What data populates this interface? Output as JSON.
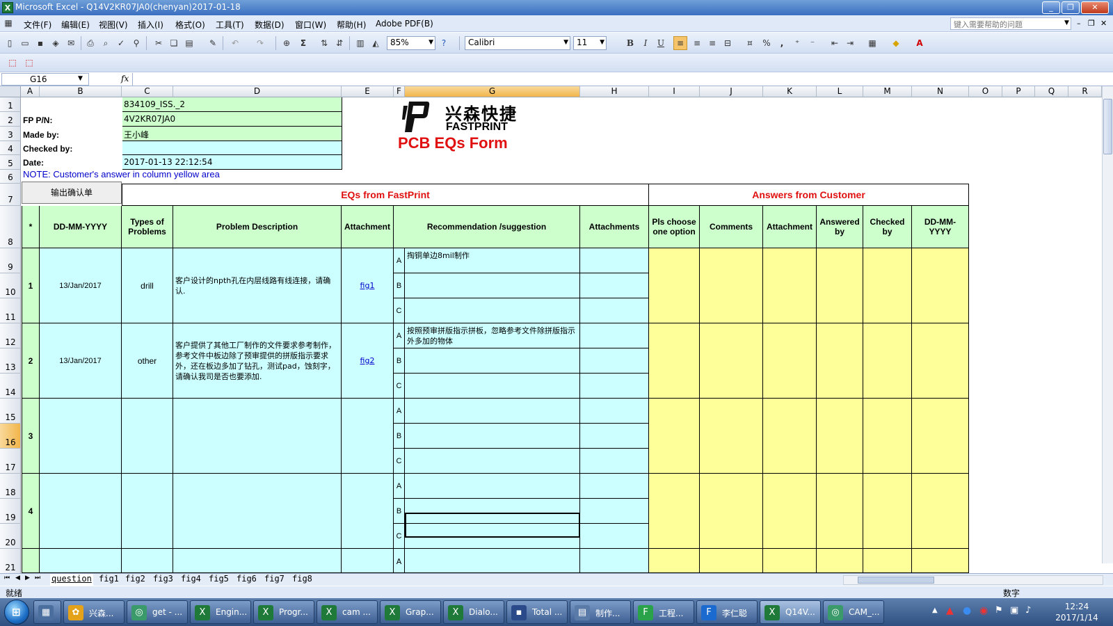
{
  "window": {
    "title": "Microsoft Excel - Q14V2KR07JA0(chenyan)2017-01-18",
    "icon_name": "excel-icon"
  },
  "menu": {
    "items": [
      "文件(F)",
      "编辑(E)",
      "视图(V)",
      "插入(I)",
      "格式(O)",
      "工具(T)",
      "数据(D)",
      "窗口(W)",
      "帮助(H)",
      "Adobe PDF(B)"
    ],
    "help_placeholder": "键入需要帮助的问题"
  },
  "toolbar": {
    "zoom": "85%",
    "font": "Calibri",
    "font_size": "11",
    "bold": "B",
    "italic": "I",
    "underline": "U",
    "percent": "%",
    "comma": ","
  },
  "formula_bar": {
    "name_box": "G16",
    "fx": "fx",
    "formula": ""
  },
  "columns": [
    "A",
    "B",
    "C",
    "D",
    "E",
    "F",
    "G",
    "H",
    "I",
    "J",
    "K",
    "L",
    "M",
    "N",
    "O",
    "P",
    "Q",
    "R"
  ],
  "selected_column": "G",
  "rows": [
    "1",
    "2",
    "3",
    "4",
    "5",
    "6",
    "7",
    "8",
    "9",
    "10",
    "11",
    "12",
    "13",
    "14",
    "15",
    "16",
    "17",
    "18",
    "19",
    "20",
    "21"
  ],
  "selected_row": "16",
  "form": {
    "header_labels": {
      "fp_pn": "FP P/N:",
      "made_by": "Made by:",
      "checked_by": "Checked by:",
      "date": "Date:"
    },
    "header_values": {
      "r1": "834109_ISS._2",
      "fp_pn": "4V2KR07JA0",
      "made_by": "王小峰",
      "checked_by": "",
      "date": "2017-01-13 22:12:54"
    },
    "logo": {
      "cn": "兴森快捷",
      "en": "FASTPRINT"
    },
    "title": "PCB EQs Form",
    "note": "NOTE: Customer's  answer in column yellow area",
    "export_button": "输出确认单",
    "section_eqs": "EQs from FastPrint",
    "section_answers": "Answers from Customer",
    "col_headers": {
      "star": "*",
      "date": "DD-MM-YYYY",
      "types": "Types of Problems",
      "problem": "Problem Description",
      "attachment": "Attachment",
      "recommendation": "Recommendation /suggestion",
      "attachments": "Attachments",
      "pls_choose": "Pls choose one option",
      "comments": "Comments",
      "attachment2": "Attachment",
      "answered_by": "Answered by",
      "checked_by": "Checked by",
      "date2": "DD-MM-YYYY"
    },
    "eqs": [
      {
        "no": "1",
        "date": "13/Jan/2017",
        "type": "drill",
        "description": "客户设计的npth孔在内层线路有线连接，请确认.",
        "attachment": "fig1",
        "options": [
          {
            "letter": "A",
            "text": "掏铜单边8mil制作"
          },
          {
            "letter": "B",
            "text": ""
          },
          {
            "letter": "C",
            "text": ""
          }
        ]
      },
      {
        "no": "2",
        "date": "13/Jan/2017",
        "type": "other",
        "description": "客户提供了其他工厂制作的文件要求参考制作，参考文件中板边除了预审提供的拼版指示要求外，还在板边多加了钻孔，测试pad，蚀刻字，请确认我司是否也要添加.",
        "attachment": "fig2",
        "options": [
          {
            "letter": "A",
            "text": "按照预审拼版指示拼板，忽略参考文件除拼版指示外多加的物体"
          },
          {
            "letter": "B",
            "text": ""
          },
          {
            "letter": "C",
            "text": ""
          }
        ]
      },
      {
        "no": "3",
        "date": "",
        "type": "",
        "description": "",
        "attachment": "",
        "options": [
          {
            "letter": "A",
            "text": ""
          },
          {
            "letter": "B",
            "text": ""
          },
          {
            "letter": "C",
            "text": ""
          }
        ]
      },
      {
        "no": "4",
        "date": "",
        "type": "",
        "description": "",
        "attachment": "",
        "options": [
          {
            "letter": "A",
            "text": ""
          },
          {
            "letter": "B",
            "text": ""
          },
          {
            "letter": "C",
            "text": ""
          }
        ]
      }
    ],
    "row21_option": "A"
  },
  "sheet_tabs": [
    "question",
    "fig1",
    "fig2",
    "fig3",
    "fig4",
    "fig5",
    "fig6",
    "fig7",
    "fig8"
  ],
  "active_sheet": "question",
  "status": {
    "ready": "就绪",
    "mode": "数字"
  },
  "taskbar": {
    "items": [
      {
        "label": "",
        "icon": "calculator-icon"
      },
      {
        "label": "兴森...",
        "icon": "flower-icon"
      },
      {
        "label": "get - ...",
        "icon": "cam-icon"
      },
      {
        "label": "Engin...",
        "icon": "excel-doc-icon"
      },
      {
        "label": "Progr...",
        "icon": "excel-doc-icon"
      },
      {
        "label": "cam ...",
        "icon": "excel-doc-icon"
      },
      {
        "label": "Grap...",
        "icon": "excel-doc-icon"
      },
      {
        "label": "Dialo...",
        "icon": "excel-doc-icon"
      },
      {
        "label": "Total ...",
        "icon": "floppy-icon"
      },
      {
        "label": "制作...",
        "icon": "notepad-icon"
      },
      {
        "label": "工程...",
        "icon": "fastprint-icon"
      },
      {
        "label": "李仁聪",
        "icon": "chat-icon"
      },
      {
        "label": "Q14V...",
        "icon": "excel-icon"
      },
      {
        "label": "CAM_...",
        "icon": "cam-icon"
      }
    ],
    "time": "12:24",
    "date": "2017/1/14"
  }
}
